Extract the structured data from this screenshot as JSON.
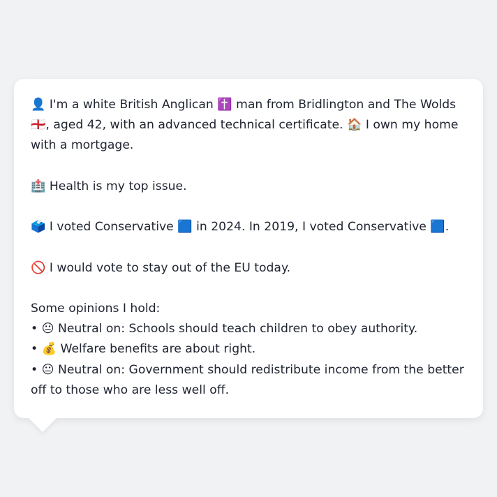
{
  "profile": {
    "line1": "👤 I'm a white British Anglican ✝️ man from Bridlington and The Wolds 🏴󠁧󠁢󠁥󠁮󠁧󠁿, aged 42, with an advanced technical certificate. 🏠 I own my home with a mortgage.",
    "line2": "🏥 Health is my top issue.",
    "line3": "🗳️ I voted Conservative 🟦 in 2024. In 2019, I voted Conservative 🟦.",
    "line4": "🚫 I would vote to stay out of the EU today.",
    "opinions_heading": "Some opinions I hold:",
    "opinions": [
      "• 😐 Neutral on: Schools should teach children to obey authority.",
      "• 💰 Welfare benefits are about right.",
      "• 😐 Neutral on: Government should redistribute income from the better off to those who are less well off."
    ]
  },
  "colors": {
    "background": "#f1f2f4",
    "bubble": "#ffffff",
    "text": "#1f2430"
  }
}
